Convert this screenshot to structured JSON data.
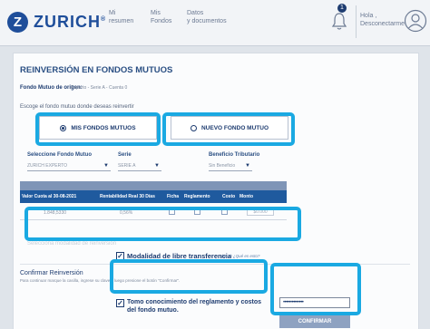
{
  "header": {
    "logo_mark": "Z",
    "logo_text": "ZURICH",
    "logo_reg": "®",
    "nav": [
      {
        "line1": "Mi",
        "line2": "resumen"
      },
      {
        "line1": "Mis",
        "line2": "Fondos"
      },
      {
        "line1": "Datos",
        "line2": "y documentos"
      }
    ],
    "notification_count": "1",
    "user_line1": "Hola ,",
    "user_line2": "Desconectarme"
  },
  "form": {
    "title": "REINVERSIÓN EN FONDOS MUTUOS",
    "origin_label": "Fondo Mutuo de origen:",
    "origin_value": "Experto - Serie A - Cuenta 0",
    "choose_text": "Escoge el fondo mutuo donde deseas reinvertir",
    "option_mis": "MIS FONDOS MUTUOS",
    "option_nuevo": "NUEVO FONDO MUTUO",
    "selected_option": "mis",
    "select_fondo_label": "Seleccione Fondo Mutuo",
    "select_fondo_value": "ZURICH EXPERTO",
    "serie_label": "Serie",
    "serie_value": "SERIE A",
    "beneficio_label": "Beneficio Tributario",
    "beneficio_value": "Sin Beneficio"
  },
  "table": {
    "headers": [
      "Valor Cuota al 30-08-2021",
      "Rentabilidad Real 30 Días",
      "Ficha",
      "Reglamento",
      "Costo",
      "Monto"
    ],
    "row": {
      "valor": "1.848,5330",
      "rentabilidad": "0,56%",
      "monto_placeholder": "$0.000"
    }
  },
  "faded_text": "Selecciona modalidad de reinversión",
  "modalidad_label": "Modalidad de libre transferencia",
  "modalidad_link": "(MLT) ¿Qué es esto?",
  "confirm": {
    "title": "Confirmar Reinversión",
    "subtitle": "Para continuar marque la casilla, ingrese su clave y luego presione el botón \"Confirmar\".",
    "tomo_text": "Tomo conocimiento del reglamento y costos del fondo mutuo.",
    "password_value": "••••••••••••••",
    "button_label": "CONFIRMAR"
  },
  "colors": {
    "brand": "#1f4e9a",
    "highlight": "#1aa9e2",
    "table_header": "#1f5a9e",
    "confirm_button": "#8ea2c1"
  }
}
